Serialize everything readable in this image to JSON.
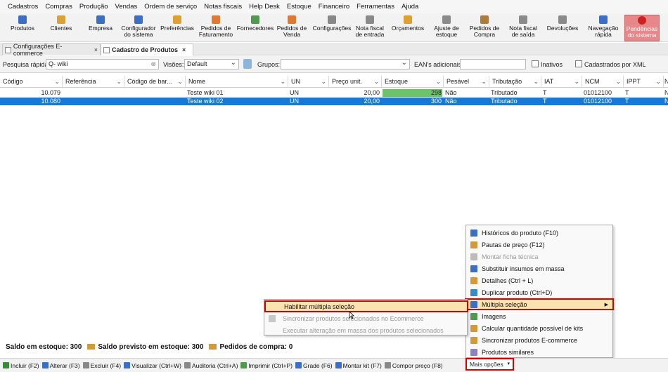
{
  "menubar": [
    "Cadastros",
    "Compras",
    "Produção",
    "Vendas",
    "Ordem de serviço",
    "Notas fiscais",
    "Help Desk",
    "Estoque",
    "Financeiro",
    "Ferramentas",
    "Ajuda"
  ],
  "toolbar": [
    {
      "label1": "Produtos",
      "label2": "",
      "icon": "box-icon",
      "color": "#3a6fc4"
    },
    {
      "label1": "Clientes",
      "label2": "",
      "icon": "person-icon",
      "color": "#d9a23a"
    },
    {
      "label1": "Empresa",
      "label2": "",
      "icon": "building-icon",
      "color": "#3a6fc4"
    },
    {
      "label1": "Configurador",
      "label2": "do sistema",
      "icon": "config-icon",
      "color": "#3a6fc4"
    },
    {
      "label1": "Preferências",
      "label2": "",
      "icon": "preferences-icon",
      "color": "#e0a030"
    },
    {
      "label1": "Pedidos de",
      "label2": "Faturamento",
      "icon": "order-icon",
      "color": "#e07a30"
    },
    {
      "label1": "Fornecedores",
      "label2": "",
      "icon": "supplier-icon",
      "color": "#4f9a4f"
    },
    {
      "label1": "Pedidos de",
      "label2": "Venda",
      "icon": "sales-order-icon",
      "color": "#e07a30"
    },
    {
      "label1": "Configurações",
      "label2": "",
      "icon": "settings-icon",
      "color": "#888888"
    },
    {
      "label1": "Nota fiscal",
      "label2": "de entrada",
      "icon": "invoice-in-icon",
      "color": "#8a8a8a"
    },
    {
      "label1": "Orçamentos",
      "label2": "",
      "icon": "quote-icon",
      "color": "#e0a030"
    },
    {
      "label1": "Ajuste de",
      "label2": "estoque",
      "icon": "stock-adjust-icon",
      "color": "#8a8a8a"
    },
    {
      "label1": "Pedidos de",
      "label2": "Compra",
      "icon": "purchase-order-icon",
      "color": "#b07a3a"
    },
    {
      "label1": "Nota fiscal",
      "label2": "de saída",
      "icon": "invoice-out-icon",
      "color": "#8a8a8a"
    },
    {
      "label1": "Devoluções",
      "label2": "",
      "icon": "returns-icon",
      "color": "#8a8a8a"
    },
    {
      "label1": "Navegação",
      "label2": "rápida",
      "icon": "navigation-icon",
      "color": "#3a6fc4"
    },
    {
      "label1": "Pendências",
      "label2": "do sistema",
      "icon": "alert-icon",
      "color": "#cc2222"
    }
  ],
  "tabs": [
    {
      "label": "Configurações E-commerce",
      "close": "×"
    },
    {
      "label": "Cadastro de Produtos",
      "close": "×"
    }
  ],
  "filter": {
    "quick_search_label": "Pesquisa rápida:",
    "quick_search_value": "Q- wiki",
    "views_label": "Visões:",
    "views_value": "Default",
    "groups_label": "Grupos:",
    "groups_value": "",
    "eans_label": "EAN's adicionais:",
    "eans_value": "",
    "inactive_label": "Inativos",
    "xml_label": "Cadastrados por XML"
  },
  "columns": [
    "Código",
    "Referência",
    "Código de bar...",
    "Nome",
    "UN",
    "Preço unit.",
    "Estoque",
    "Pesável",
    "Tributação",
    "IAT",
    "NCM",
    "IPPT",
    "N"
  ],
  "rows": [
    {
      "codigo": "10.079",
      "referencia": "",
      "codbarras": "",
      "nome": "Teste wiki 01",
      "un": "UN",
      "preco": "20,00",
      "estoque": "298",
      "estoque_fill": 0.99,
      "pesavel": "Não",
      "tributacao": "Tributado",
      "iat": "T",
      "ncm": "01012100",
      "ippt": "T",
      "n": "N"
    },
    {
      "codigo": "10.080",
      "referencia": "",
      "codbarras": "",
      "nome": "Teste wiki 02",
      "un": "UN",
      "preco": "20,00",
      "estoque": "300",
      "estoque_fill": 1.0,
      "pesavel": "Não",
      "tributacao": "Tributado",
      "iat": "T",
      "ncm": "01012100",
      "ippt": "T",
      "n": "N"
    }
  ],
  "status": {
    "saldo": "Saldo em estoque: 300",
    "previsto": "Saldo previsto em estoque: 300",
    "pedidos": "Pedidos de compra: 0"
  },
  "bottom": [
    {
      "label": "Incluir (F2)",
      "icon": "add-icon",
      "color": "#3a8a3a"
    },
    {
      "label": "Alterar (F3)",
      "icon": "edit-icon",
      "color": "#3a6fc4"
    },
    {
      "label": "Excluir (F4)",
      "icon": "delete-icon",
      "color": "#888888"
    },
    {
      "label": "Visualizar (Ctrl+W)",
      "icon": "view-icon",
      "color": "#3a6fc4"
    },
    {
      "label": "Auditoria (Ctrl+A)",
      "icon": "audit-icon",
      "color": "#888888"
    },
    {
      "label": "Imprimir (Ctrl+P)",
      "icon": "print-icon",
      "color": "#4f9a4f"
    },
    {
      "label": "Grade (F6)",
      "icon": "grid-icon",
      "color": "#3a6fc4"
    },
    {
      "label": "Montar kit (F7)",
      "icon": "kit-icon",
      "color": "#3a6fc4"
    },
    {
      "label": "Compor preço (F8)",
      "icon": "price-icon",
      "color": "#888888"
    }
  ],
  "more_options": "Mais opções",
  "context_menu": [
    {
      "label": "Históricos do produto (F10)",
      "icon": "history-icon",
      "disabled": false
    },
    {
      "label": "Pautas de preço (F12)",
      "icon": "price-list-icon",
      "disabled": false
    },
    {
      "label": "Montar ficha técnica",
      "icon": "datasheet-icon",
      "disabled": true
    },
    {
      "label": "Substituir insumos em massa",
      "icon": "replace-icon",
      "disabled": false
    },
    {
      "label": "Detalhes (Ctrl + L)",
      "icon": "details-icon",
      "disabled": false
    },
    {
      "label": "Duplicar produto (Ctrl+D)",
      "icon": "duplicate-icon",
      "disabled": false
    },
    {
      "label": "Múltipla seleção",
      "icon": "multi-select-icon",
      "disabled": false,
      "submenu": true
    },
    {
      "label": "Imagens",
      "icon": "images-icon",
      "disabled": false
    },
    {
      "label": "Calcular quantidade possível de kits",
      "icon": "calc-icon",
      "disabled": false
    },
    {
      "label": "Sincronizar produtos E-commerce",
      "icon": "sync-icon",
      "disabled": false
    },
    {
      "label": "Produtos similares",
      "icon": "similar-icon",
      "disabled": false
    }
  ],
  "submenu": [
    {
      "label": "Habilitar múltipla seleção",
      "disabled": false
    },
    {
      "label": "Sincronizar produtos selecionados no Ecommerce",
      "disabled": true
    },
    {
      "label": "Executar alteração em massa dos produtos selecionados",
      "disabled": true
    }
  ],
  "colors": {
    "selected_row": "#1779d6",
    "stock_bar": "#6cc36a",
    "highlight": "#fbe3b0",
    "red_outline": "#d40000"
  }
}
